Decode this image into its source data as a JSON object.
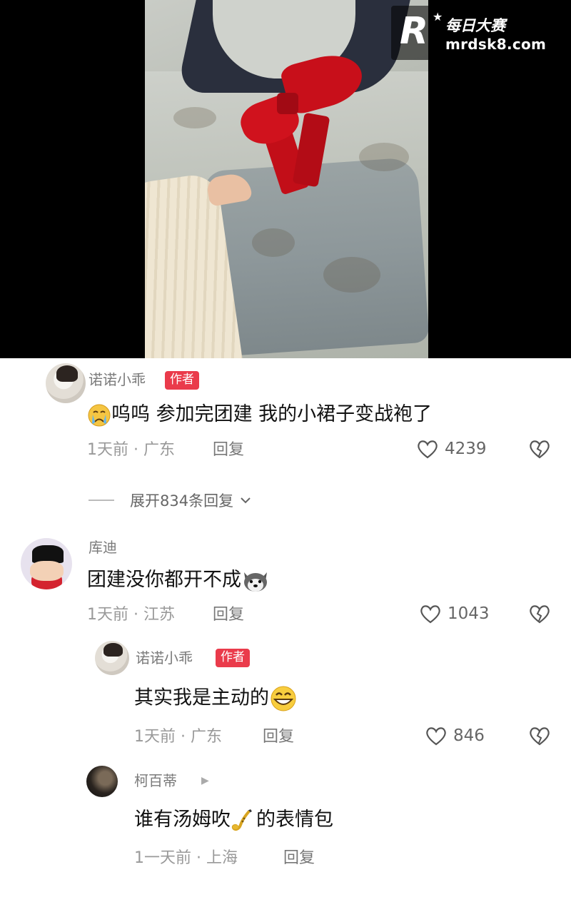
{
  "watermark": {
    "logo_letter": "R",
    "name": "每日大赛",
    "url": "mrdsk8.com"
  },
  "comments": [
    {
      "user": "诺诺小乖",
      "badge": "作者",
      "text": "呜呜 参加完团建 我的小裙子变战袍了",
      "emoji": "crying-face",
      "meta": "1天前 · 广东",
      "reply_label": "回复",
      "likes": "4239"
    },
    {
      "user": "库迪",
      "text": "团建没你都开不成",
      "emoji": "husky-dog-face",
      "meta": "1天前 · 江苏",
      "reply_label": "回复",
      "likes": "1043"
    },
    {
      "user": "诺诺小乖",
      "badge": "作者",
      "text": "其实我是主动的",
      "emoji": "grinning-face",
      "meta": "1天前 · 广东",
      "reply_label": "回复",
      "likes": "846"
    },
    {
      "user": "柯百蒂",
      "text_before": "谁有汤姆吹",
      "emoji": "saxophone",
      "text_after": "的表情包",
      "meta": "1一天前 · 上海",
      "reply_label": "回复"
    }
  ],
  "expand_replies": "展开834条回复",
  "colors": {
    "author_badge": "#e33b4a",
    "meta_gray": "#999999",
    "background": "#ffffff"
  }
}
